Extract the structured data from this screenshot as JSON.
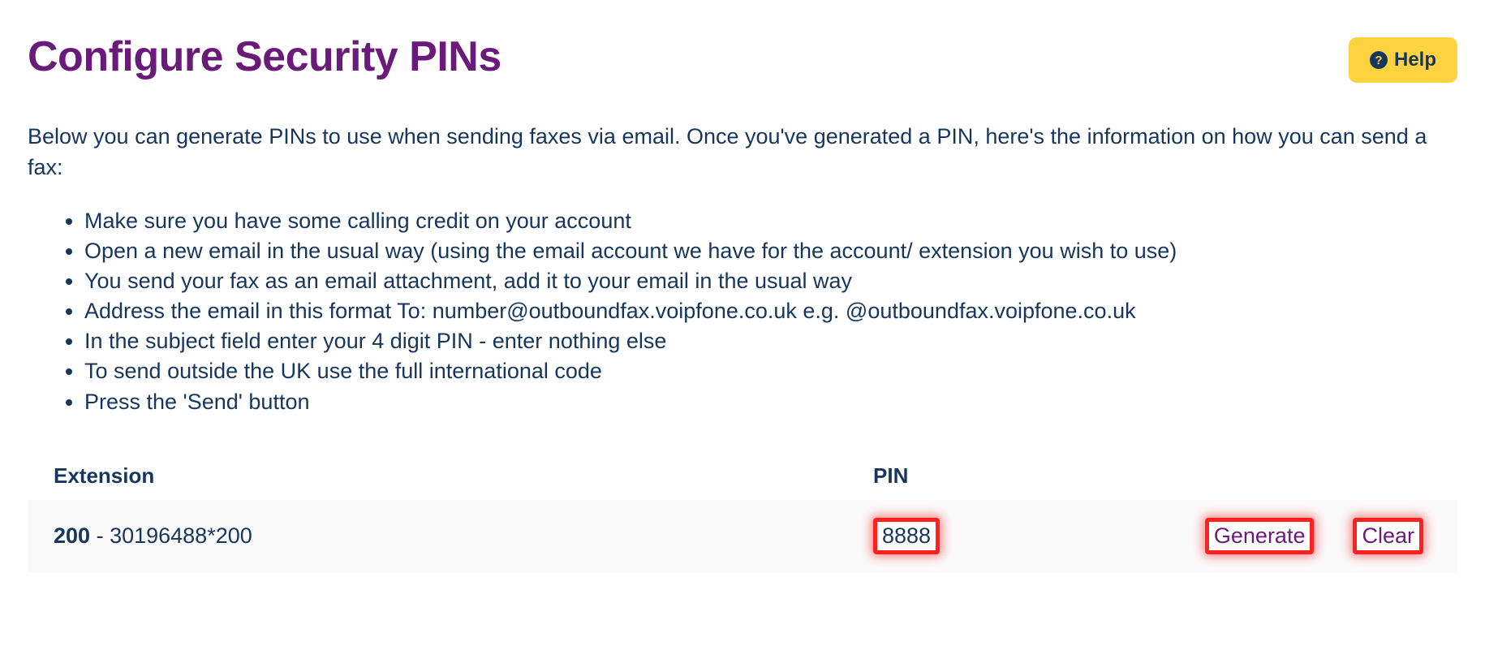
{
  "header": {
    "title": "Configure Security PINs",
    "help_label": "Help"
  },
  "intro": "Below you can generate PINs to use when sending faxes via email. Once you've generated a PIN, here's the information on how you can send a fax:",
  "instructions": [
    "Make sure you have some calling credit on your account",
    "Open a new email in the usual way (using the email account we have for the account/ extension you wish to use)",
    "You send your fax as an email attachment, add it to your email in the usual way",
    "Address the email in this format To: number@outboundfax.voipfone.co.uk e.g. @outboundfax.voipfone.co.uk",
    "In the subject field enter your 4 digit PIN - enter nothing else",
    "To send outside the UK use the full international code",
    "Press the 'Send' button"
  ],
  "table": {
    "columns": {
      "extension": "Extension",
      "pin": "PIN"
    },
    "rows": [
      {
        "ext_number": "200",
        "ext_separator": " - ",
        "ext_detail": "30196488*200",
        "pin": "8888",
        "generate_label": "Generate",
        "clear_label": "Clear"
      }
    ]
  }
}
